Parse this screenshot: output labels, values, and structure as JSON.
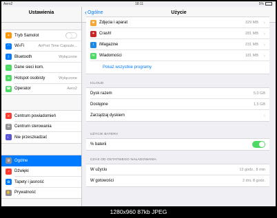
{
  "status": {
    "carrier": "Aero2",
    "time": "18:11",
    "battery": "5%"
  },
  "sidebar": {
    "title": "Ustawienia",
    "group1": [
      {
        "label": "Tryb Samolot",
        "icon": "airplane-icon",
        "color": "#ff9500",
        "glyph": "✈"
      },
      {
        "label": "Wi-Fi",
        "value": "AirPort Time Capsule...",
        "icon": "wifi-icon",
        "color": "#007aff",
        "glyph": "◠"
      },
      {
        "label": "Bluetooth",
        "value": "Wyłączone",
        "icon": "bluetooth-icon",
        "color": "#007aff",
        "glyph": "ᛒ"
      },
      {
        "label": "Dane sieci kom.",
        "icon": "cellular-icon",
        "color": "#4cd964",
        "glyph": "⋯"
      },
      {
        "label": "Hotspot osobisty",
        "value": "Wyłączone",
        "icon": "hotspot-icon",
        "color": "#4cd964",
        "glyph": "∞"
      },
      {
        "label": "Operator",
        "value": "Aero2",
        "icon": "phone-icon",
        "color": "#4cd964",
        "glyph": "☎"
      }
    ],
    "group2": [
      {
        "label": "Centrum powiadomień",
        "icon": "notifications-icon",
        "color": "#ff3b30",
        "glyph": "≡"
      },
      {
        "label": "Centrum sterowania",
        "icon": "control-center-icon",
        "color": "#8e8e93",
        "glyph": "☰"
      },
      {
        "label": "Nie przeszkadzać",
        "icon": "moon-icon",
        "color": "#5856d6",
        "glyph": "☾"
      }
    ],
    "group3": [
      {
        "label": "Ogólne",
        "icon": "gear-icon",
        "color": "#8e8e93",
        "glyph": "⚙",
        "active": true
      },
      {
        "label": "Dźwięki",
        "icon": "sound-icon",
        "color": "#ff3b30",
        "glyph": "♪"
      },
      {
        "label": "Tapety i jasność",
        "icon": "wallpaper-icon",
        "color": "#007aff",
        "glyph": "✿"
      },
      {
        "label": "Prywatność",
        "icon": "privacy-icon",
        "color": "#8e8e93",
        "glyph": "✋"
      }
    ]
  },
  "main": {
    "back_label": "Ogólne",
    "title": "Użycie",
    "apps": [
      {
        "name": "Zdjęcia i aparat",
        "size": "329 MB",
        "icon": "photos-icon",
        "color": "#f4a83a",
        "glyph": "❀"
      },
      {
        "name": "Crash!",
        "size": "281 MB",
        "icon": "crash-app-icon",
        "color": "#c62828",
        "glyph": "✦"
      },
      {
        "name": "iMagazine",
        "size": "231 MB",
        "icon": "imagazine-icon",
        "color": "#1e88e5",
        "glyph": "i"
      },
      {
        "name": "Wiadomości",
        "size": "181 MB",
        "icon": "messages-icon",
        "color": "#4cd964",
        "glyph": "✉"
      }
    ],
    "show_all": "Pokaż wszystkie programy",
    "icloud": {
      "header": "ICLOUD",
      "rows": [
        {
          "label": "Dysk razem",
          "value": "5,0 GB"
        },
        {
          "label": "Dostępne",
          "value": "1,5 GB"
        },
        {
          "label": "Zarządzaj dyskiem"
        }
      ]
    },
    "battery": {
      "header": "UŻYCIE BATERII",
      "label": "% baterii"
    },
    "since_charge": {
      "header": "CZAS OD OSTATNIEGO NAŁADOWANIA",
      "rows": [
        {
          "label": "W użyciu",
          "value": "12 godz., 8 min"
        },
        {
          "label": "W gotowości",
          "value": "2 dni, 8 godz."
        }
      ]
    }
  },
  "caption": "1280x960 87kb JPEG"
}
